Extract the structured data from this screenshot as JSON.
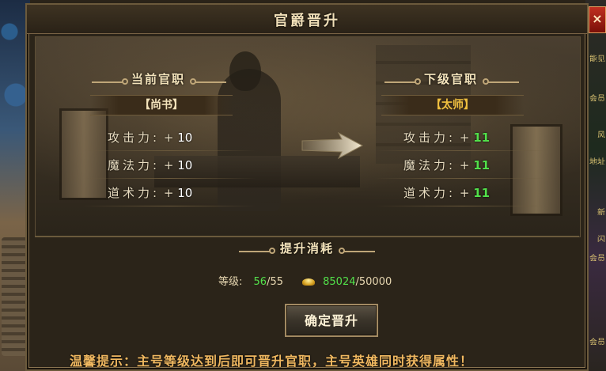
{
  "window": {
    "title": "官爵晋升",
    "close_label": "×"
  },
  "current": {
    "header": "当前官职",
    "rank": "【尚书】",
    "rank_color": "#f3e3bb",
    "stats": [
      {
        "label": "攻击力:",
        "plus": "+",
        "value": "10"
      },
      {
        "label": "魔法力:",
        "plus": "+",
        "value": "10"
      },
      {
        "label": "道术力:",
        "plus": "+",
        "value": "10"
      }
    ]
  },
  "next": {
    "header": "下级官职",
    "rank": "【太师】",
    "rank_color": "#f0c040",
    "stats": [
      {
        "label": "攻击力:",
        "plus": "+",
        "value": "11"
      },
      {
        "label": "魔法力:",
        "plus": "+",
        "value": "11"
      },
      {
        "label": "道术力:",
        "plus": "+",
        "value": "11"
      }
    ]
  },
  "cost": {
    "header": "提升消耗",
    "level_label": "等级:",
    "level_current": "56",
    "level_required": "/55",
    "gold_current": "85024",
    "gold_required": "/50000"
  },
  "confirm_label": "确定晋升",
  "tip": "温馨提示：主号等级达到后即可晋升官职，主号英雄同时获得属性！",
  "colors": {
    "accent_green": "#52e04a",
    "tip_orange": "#f0b860",
    "frame": "#6b5a3c"
  },
  "right_edge_tags": [
    "能见",
    "会员",
    "风",
    "地址",
    "新",
    "闪",
    "会员",
    "会员"
  ]
}
